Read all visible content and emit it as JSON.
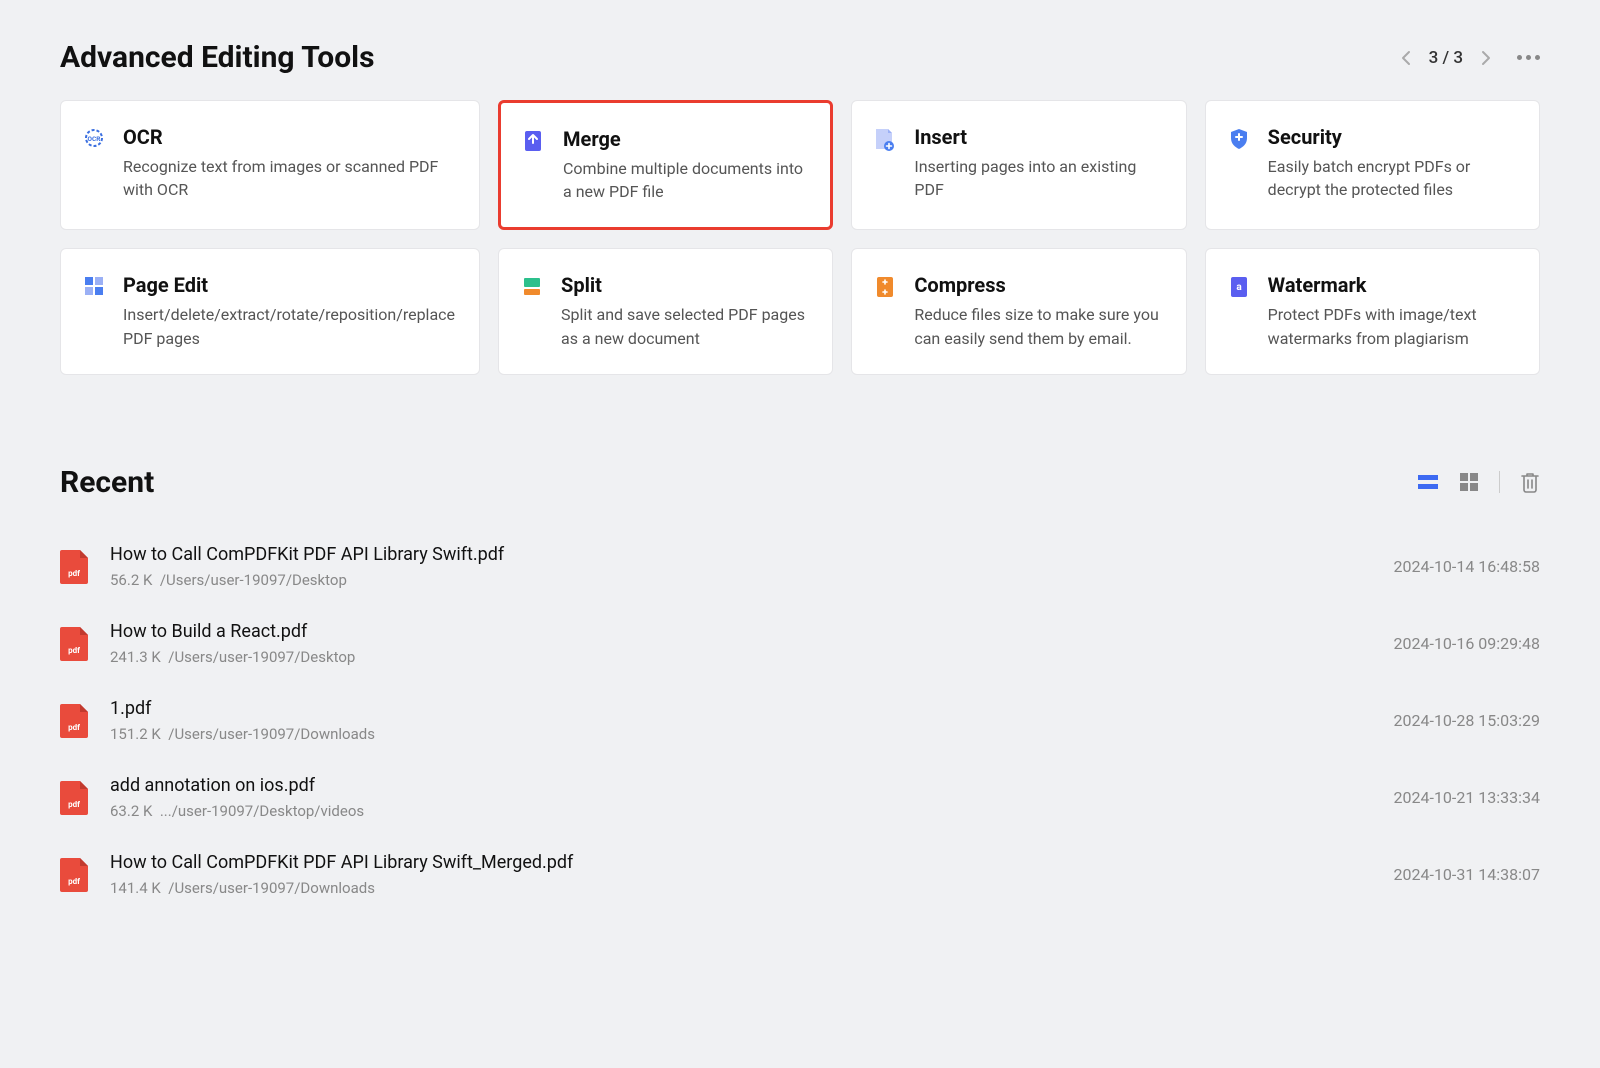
{
  "header": {
    "title": "Advanced Editing Tools",
    "page_indicator": "3 / 3"
  },
  "tools": [
    {
      "icon": "ocr",
      "color": "#3b6fe0",
      "title": "OCR",
      "desc": "Recognize text from images or scanned PDF with OCR",
      "highlighted": false
    },
    {
      "icon": "merge",
      "color": "#5a5ef0",
      "title": "Merge",
      "desc": "Combine multiple documents into a new PDF file",
      "highlighted": true
    },
    {
      "icon": "insert",
      "color": "#6a86f5",
      "title": "Insert",
      "desc": "Inserting pages into an existing PDF",
      "highlighted": false
    },
    {
      "icon": "security",
      "color": "#4a7ef0",
      "title": "Security",
      "desc": "Easily batch encrypt PDFs or decrypt the protected files",
      "highlighted": false
    },
    {
      "icon": "pageedit",
      "color": "#4a7ef0",
      "title": "Page Edit",
      "desc": "Insert/delete/extract/rotate/reposition/replace PDF pages",
      "highlighted": false
    },
    {
      "icon": "split",
      "color": "#2cc08c",
      "title": "Split",
      "desc": "Split and save selected PDF pages as a new document",
      "highlighted": false
    },
    {
      "icon": "compress",
      "color": "#f08a2c",
      "title": "Compress",
      "desc": "Reduce files size to make sure you can easily send them by email.",
      "highlighted": false
    },
    {
      "icon": "watermark",
      "color": "#5a5ef0",
      "title": "Watermark",
      "desc": "Protect PDFs with image/text watermarks from plagiarism",
      "highlighted": false
    }
  ],
  "recent": {
    "title": "Recent",
    "items": [
      {
        "name": "How to Call ComPDFKit PDF API Library Swift.pdf",
        "size": "56.2 K",
        "path": "/Users/user-19097/Desktop",
        "date": "2024-10-14 16:48:58"
      },
      {
        "name": "How to Build a React.pdf",
        "size": "241.3 K",
        "path": "/Users/user-19097/Desktop",
        "date": "2024-10-16 09:29:48"
      },
      {
        "name": "1.pdf",
        "size": "151.2 K",
        "path": "/Users/user-19097/Downloads",
        "date": "2024-10-28 15:03:29"
      },
      {
        "name": "add annotation on ios.pdf",
        "size": "63.2 K",
        "path": ".../user-19097/Desktop/videos",
        "date": "2024-10-21 13:33:34"
      },
      {
        "name": "How to Call ComPDFKit PDF API Library Swift_Merged.pdf",
        "size": "141.4 K",
        "path": "/Users/user-19097/Downloads",
        "date": "2024-10-31 14:38:07"
      }
    ]
  }
}
